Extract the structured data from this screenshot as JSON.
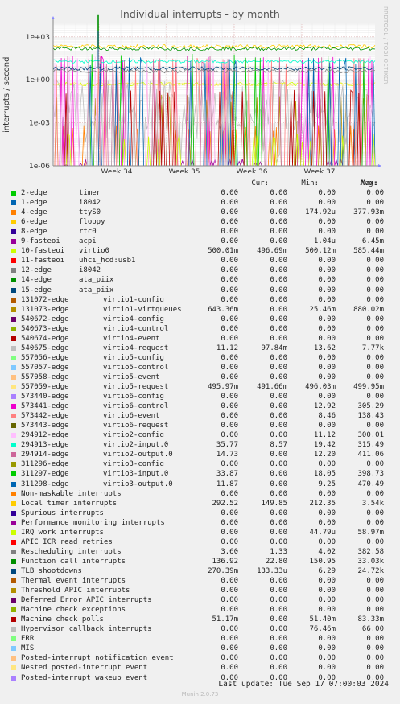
{
  "chart_data": {
    "type": "line",
    "title": "Individual interrupts - by month",
    "ylabel": "interrupts / second",
    "side_text": "RRDTOOL / TOBI OETIKER",
    "y_scale": "log",
    "ylim": [
      1e-06,
      10000
    ],
    "y_ticks": [
      "1e+03",
      "1e+00",
      "1e-03",
      "1e-06"
    ],
    "x_ticks": [
      "Week 34",
      "Week 35",
      "Week 36",
      "Week 37"
    ],
    "legend_columns": [
      "Cur:",
      "Min:",
      "Avg:",
      "Max:"
    ],
    "series": [
      {
        "name": "2-edge",
        "label": "timer",
        "color": "#00cc00",
        "cur": "0.00",
        "min": "0.00",
        "avg": "0.00",
        "max": "0.00"
      },
      {
        "name": "1-edge",
        "label": "i8042",
        "color": "#0066b3",
        "cur": "0.00",
        "min": "0.00",
        "avg": "0.00",
        "max": "0.00"
      },
      {
        "name": "4-edge",
        "label": "ttyS0",
        "color": "#ff8000",
        "cur": "0.00",
        "min": "0.00",
        "avg": "174.92u",
        "max": "377.93m"
      },
      {
        "name": "6-edge",
        "label": "floppy",
        "color": "#ffcc00",
        "cur": "0.00",
        "min": "0.00",
        "avg": "0.00",
        "max": "0.00"
      },
      {
        "name": "8-edge",
        "label": "rtc0",
        "color": "#330099",
        "cur": "0.00",
        "min": "0.00",
        "avg": "0.00",
        "max": "0.00"
      },
      {
        "name": "9-fasteoi",
        "label": "acpi",
        "color": "#990099",
        "cur": "0.00",
        "min": "0.00",
        "avg": "1.04u",
        "max": "6.45m"
      },
      {
        "name": "10-fasteoi",
        "label": "virtio0",
        "color": "#ccff00",
        "cur": "500.01m",
        "min": "496.69m",
        "avg": "500.12m",
        "max": "585.44m"
      },
      {
        "name": "11-fasteoi",
        "label": "uhci_hcd:usb1",
        "color": "#ff0000",
        "cur": "0.00",
        "min": "0.00",
        "avg": "0.00",
        "max": "0.00"
      },
      {
        "name": "12-edge",
        "label": "i8042",
        "color": "#808080",
        "cur": "0.00",
        "min": "0.00",
        "avg": "0.00",
        "max": "0.00"
      },
      {
        "name": "14-edge",
        "label": "ata_piix",
        "color": "#008f00",
        "cur": "0.00",
        "min": "0.00",
        "avg": "0.00",
        "max": "0.00"
      },
      {
        "name": "15-edge",
        "label": "ata_piix",
        "color": "#00487d",
        "cur": "0.00",
        "min": "0.00",
        "avg": "0.00",
        "max": "0.00"
      },
      {
        "name": "131072-edge",
        "label": "virtio1-config",
        "color": "#b35a00",
        "cur": "0.00",
        "min": "0.00",
        "avg": "0.00",
        "max": "0.00"
      },
      {
        "name": "131073-edge",
        "label": "virtio1-virtqueues",
        "color": "#b38f00",
        "cur": "643.36m",
        "min": "0.00",
        "avg": "25.46m",
        "max": "880.02m"
      },
      {
        "name": "540672-edge",
        "label": "virtio4-config",
        "color": "#6b006b",
        "cur": "0.00",
        "min": "0.00",
        "avg": "0.00",
        "max": "0.00"
      },
      {
        "name": "540673-edge",
        "label": "virtio4-control",
        "color": "#8fb300",
        "cur": "0.00",
        "min": "0.00",
        "avg": "0.00",
        "max": "0.00"
      },
      {
        "name": "540674-edge",
        "label": "virtio4-event",
        "color": "#b30000",
        "cur": "0.00",
        "min": "0.00",
        "avg": "0.00",
        "max": "0.00"
      },
      {
        "name": "540675-edge",
        "label": "virtio4-request",
        "color": "#bebebe",
        "cur": "11.12",
        "min": "97.84m",
        "avg": "13.62",
        "max": "7.77k"
      },
      {
        "name": "557056-edge",
        "label": "virtio5-config",
        "color": "#80ff80",
        "cur": "0.00",
        "min": "0.00",
        "avg": "0.00",
        "max": "0.00"
      },
      {
        "name": "557057-edge",
        "label": "virtio5-control",
        "color": "#80c9ff",
        "cur": "0.00",
        "min": "0.00",
        "avg": "0.00",
        "max": "0.00"
      },
      {
        "name": "557058-edge",
        "label": "virtio5-event",
        "color": "#ffc080",
        "cur": "0.00",
        "min": "0.00",
        "avg": "0.00",
        "max": "0.00"
      },
      {
        "name": "557059-edge",
        "label": "virtio5-request",
        "color": "#ffe680",
        "cur": "495.97m",
        "min": "491.66m",
        "avg": "496.03m",
        "max": "499.95m"
      },
      {
        "name": "573440-edge",
        "label": "virtio6-config",
        "color": "#aa80ff",
        "cur": "0.00",
        "min": "0.00",
        "avg": "0.00",
        "max": "0.00"
      },
      {
        "name": "573441-edge",
        "label": "virtio6-control",
        "color": "#ee00cc",
        "cur": "0.00",
        "min": "0.00",
        "avg": "12.92",
        "max": "305.29"
      },
      {
        "name": "573442-edge",
        "label": "virtio6-event",
        "color": "#ff8080",
        "cur": "0.00",
        "min": "0.00",
        "avg": "8.46",
        "max": "138.43"
      },
      {
        "name": "573443-edge",
        "label": "virtio6-request",
        "color": "#666600",
        "cur": "0.00",
        "min": "0.00",
        "avg": "0.00",
        "max": "0.00"
      },
      {
        "name": "294912-edge",
        "label": "virtio2-config",
        "color": "#ffbfff",
        "cur": "0.00",
        "min": "0.00",
        "avg": "11.12",
        "max": "300.01"
      },
      {
        "name": "294913-edge",
        "label": "virtio2-input.0",
        "color": "#00ffcc",
        "cur": "35.77",
        "min": "8.57",
        "avg": "19.42",
        "max": "315.49"
      },
      {
        "name": "294914-edge",
        "label": "virtio2-output.0",
        "color": "#cc6699",
        "cur": "14.73",
        "min": "0.00",
        "avg": "12.20",
        "max": "411.06"
      },
      {
        "name": "311296-edge",
        "label": "virtio3-config",
        "color": "#999900",
        "cur": "0.00",
        "min": "0.00",
        "avg": "0.00",
        "max": "0.00"
      },
      {
        "name": "311297-edge",
        "label": "virtio3-input.0",
        "color": "#00cc00",
        "cur": "33.87",
        "min": "0.00",
        "avg": "18.05",
        "max": "398.73"
      },
      {
        "name": "311298-edge",
        "label": "virtio3-output.0",
        "color": "#0066b3",
        "cur": "11.87",
        "min": "0.00",
        "avg": "9.25",
        "max": "470.49"
      },
      {
        "name": "Non-maskable interrupts",
        "label": "",
        "color": "#ff8000",
        "cur": "0.00",
        "min": "0.00",
        "avg": "0.00",
        "max": "0.00"
      },
      {
        "name": "Local timer interrupts",
        "label": "",
        "color": "#ffcc00",
        "cur": "292.52",
        "min": "149.85",
        "avg": "212.35",
        "max": "3.54k"
      },
      {
        "name": "Spurious interrupts",
        "label": "",
        "color": "#330099",
        "cur": "0.00",
        "min": "0.00",
        "avg": "0.00",
        "max": "0.00"
      },
      {
        "name": "Performance monitoring interrupts",
        "label": "",
        "color": "#990099",
        "cur": "0.00",
        "min": "0.00",
        "avg": "0.00",
        "max": "0.00"
      },
      {
        "name": "IRQ work interrupts",
        "label": "",
        "color": "#ccff00",
        "cur": "0.00",
        "min": "0.00",
        "avg": "44.79u",
        "max": "58.97m"
      },
      {
        "name": "APIC ICR read retries",
        "label": "",
        "color": "#ff0000",
        "cur": "0.00",
        "min": "0.00",
        "avg": "0.00",
        "max": "0.00"
      },
      {
        "name": "Rescheduling interrupts",
        "label": "",
        "color": "#808080",
        "cur": "3.60",
        "min": "1.33",
        "avg": "4.02",
        "max": "382.58"
      },
      {
        "name": "Function call interrupts",
        "label": "",
        "color": "#008f00",
        "cur": "136.92",
        "min": "22.80",
        "avg": "150.95",
        "max": "33.03k"
      },
      {
        "name": "TLB shootdowns",
        "label": "",
        "color": "#00487d",
        "cur": "270.39m",
        "min": "133.33u",
        "avg": "6.29",
        "max": "24.72k"
      },
      {
        "name": "Thermal event interrupts",
        "label": "",
        "color": "#b35a00",
        "cur": "0.00",
        "min": "0.00",
        "avg": "0.00",
        "max": "0.00"
      },
      {
        "name": "Threshold APIC interrupts",
        "label": "",
        "color": "#b38f00",
        "cur": "0.00",
        "min": "0.00",
        "avg": "0.00",
        "max": "0.00"
      },
      {
        "name": "Deferred Error APIC interrupts",
        "label": "",
        "color": "#6b006b",
        "cur": "0.00",
        "min": "0.00",
        "avg": "0.00",
        "max": "0.00"
      },
      {
        "name": "Machine check exceptions",
        "label": "",
        "color": "#8fb300",
        "cur": "0.00",
        "min": "0.00",
        "avg": "0.00",
        "max": "0.00"
      },
      {
        "name": "Machine check polls",
        "label": "",
        "color": "#b30000",
        "cur": "51.17m",
        "min": "0.00",
        "avg": "51.40m",
        "max": "83.33m"
      },
      {
        "name": "Hypervisor callback interrupts",
        "label": "",
        "color": "#bebebe",
        "cur": "0.00",
        "min": "0.00",
        "avg": "76.46m",
        "max": "66.00"
      },
      {
        "name": "ERR",
        "label": "",
        "color": "#80ff80",
        "cur": "0.00",
        "min": "0.00",
        "avg": "0.00",
        "max": "0.00"
      },
      {
        "name": "MIS",
        "label": "",
        "color": "#80c9ff",
        "cur": "0.00",
        "min": "0.00",
        "avg": "0.00",
        "max": "0.00"
      },
      {
        "name": "Posted-interrupt notification event",
        "label": "",
        "color": "#ffc080",
        "cur": "0.00",
        "min": "0.00",
        "avg": "0.00",
        "max": "0.00"
      },
      {
        "name": "Nested posted-interrupt event",
        "label": "",
        "color": "#ffe680",
        "cur": "0.00",
        "min": "0.00",
        "avg": "0.00",
        "max": "0.00"
      },
      {
        "name": "Posted-interrupt wakeup event",
        "label": "",
        "color": "#aa80ff",
        "cur": "0.00",
        "min": "0.00",
        "avg": "0.00",
        "max": "0.00"
      }
    ]
  },
  "footer": {
    "last_update": "Last update: Tue Sep 17 07:00:03 2024",
    "munin": "Munin 2.0.73"
  }
}
